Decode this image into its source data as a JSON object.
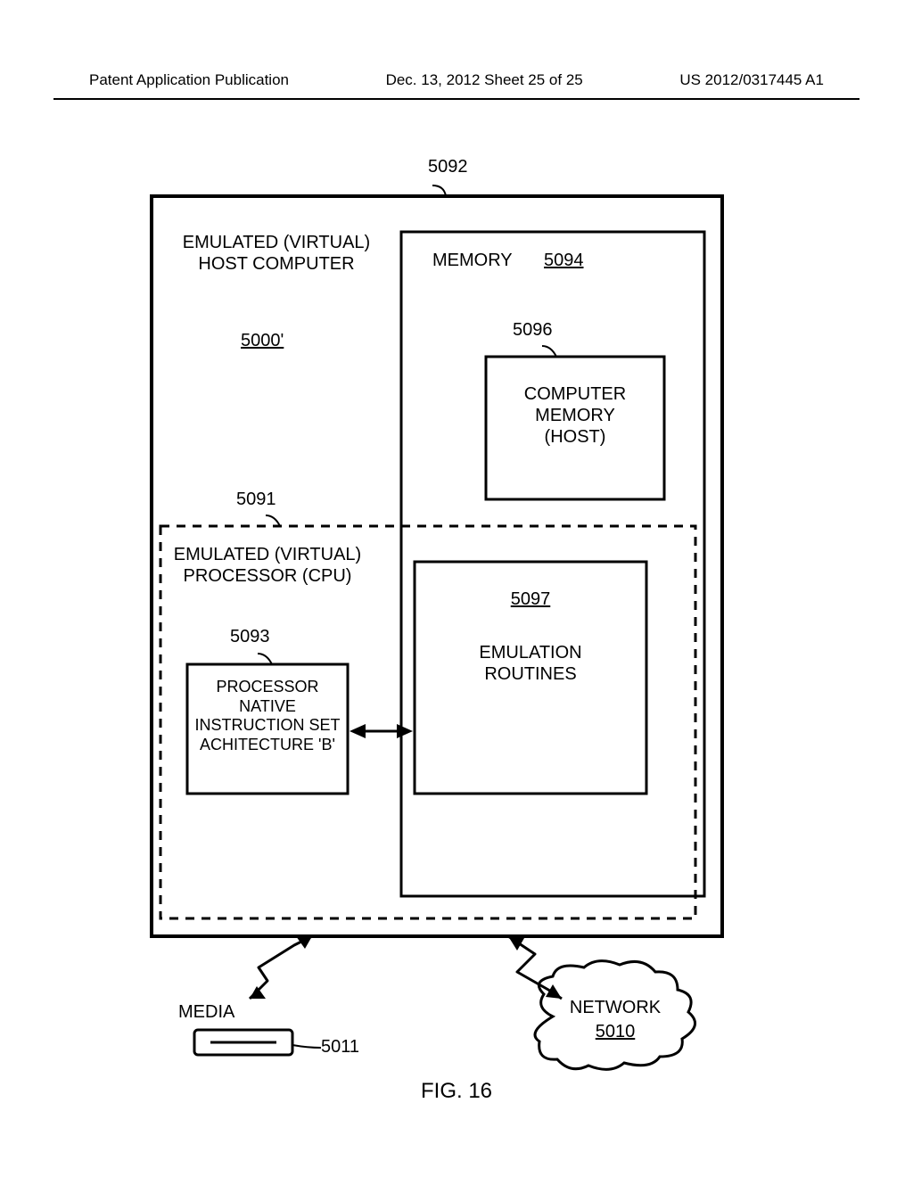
{
  "header": {
    "left": "Patent Application Publication",
    "center": "Dec. 13, 2012  Sheet 25 of 25",
    "right": "US 2012/0317445 A1"
  },
  "labels": {
    "ref5092": "5092",
    "emu_host_title": "EMULATED (VIRTUAL)\nHOST COMPUTER",
    "ref5000p": "5000'",
    "memory_title": "MEMORY",
    "ref5094": "5094",
    "ref5096": "5096",
    "computer_memory_host": "COMPUTER\nMEMORY\n(HOST)",
    "ref5091": "5091",
    "emu_cpu_title": "EMULATED (VIRTUAL)\nPROCESSOR (CPU)",
    "ref5097": "5097",
    "emulation_routines": "EMULATION\nROUTINES",
    "ref5093": "5093",
    "processor_native": "PROCESSOR\nNATIVE\nINSTRUCTION SET\nACHITECTURE 'B'",
    "media": "MEDIA",
    "ref5011": "5011",
    "network": "NETWORK",
    "ref5010": "5010"
  },
  "figure_caption": "FIG. 16"
}
